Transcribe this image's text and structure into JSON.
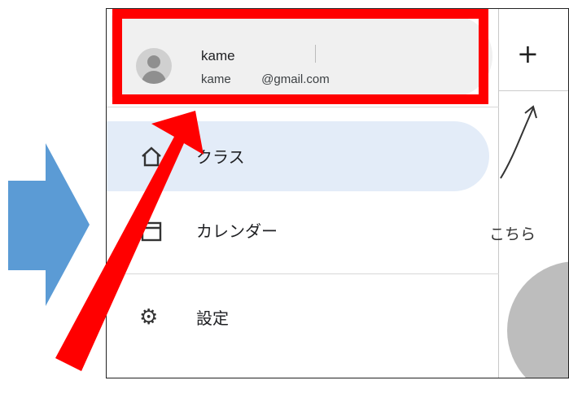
{
  "account": {
    "name": "kame",
    "email": "kame         @gmail.com"
  },
  "nav": {
    "items": [
      {
        "label": "クラス",
        "icon": "home-icon"
      },
      {
        "label": "カレンダー",
        "icon": "calendar-icon"
      },
      {
        "label": "設定",
        "icon": "gear-icon"
      }
    ]
  },
  "right_pane": {
    "add_label": "+",
    "text": "こちら"
  },
  "colors": {
    "highlight": "#ff0000",
    "arrow_blue": "#5b9bd5",
    "active_bg": "#e3ecf8"
  }
}
